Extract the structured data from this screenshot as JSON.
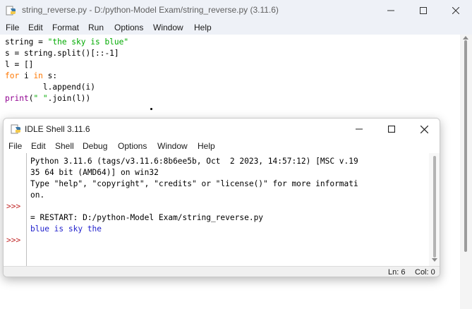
{
  "editor": {
    "title": "string_reverse.py - D:/python-Model Exam/string_reverse.py (3.11.6)",
    "menu": [
      "File",
      "Edit",
      "Format",
      "Run",
      "Options",
      "Window",
      "Help"
    ]
  },
  "code": [
    [
      {
        "t": "string = ",
        "c": "plain"
      },
      {
        "t": "\"the sky is blue\"",
        "c": "str"
      }
    ],
    [
      {
        "t": "s = string.split()[::-1]",
        "c": "plain"
      }
    ],
    [
      {
        "t": "l = []",
        "c": "plain"
      }
    ],
    [
      {
        "t": "for",
        "c": "kw"
      },
      {
        "t": " i ",
        "c": "plain"
      },
      {
        "t": "in",
        "c": "kw"
      },
      {
        "t": " s:",
        "c": "plain"
      }
    ],
    [
      {
        "t": "        l.append(i)",
        "c": "plain"
      }
    ],
    [
      {
        "t": "print",
        "c": "bi"
      },
      {
        "t": "(",
        "c": "plain"
      },
      {
        "t": "\" \"",
        "c": "str"
      },
      {
        "t": ".join(l))",
        "c": "plain"
      }
    ]
  ],
  "shell": {
    "title": "IDLE Shell 3.11.6",
    "menu": [
      "File",
      "Edit",
      "Shell",
      "Debug",
      "Options",
      "Window",
      "Help"
    ],
    "lines": [
      "Python 3.11.6 (tags/v3.11.6:8b6ee5b, Oct  2 2023, 14:57:12) [MSC v.19",
      "35 64 bit (AMD64)] on win32",
      "Type \"help\", \"copyright\", \"credits\" or \"license()\" for more informati",
      "on.",
      "",
      "= RESTART: D:/python-Model Exam/string_reverse.py",
      "blue is sky the"
    ],
    "prompts": [
      ">>>",
      ">>>"
    ],
    "status": {
      "ln": "Ln: 6",
      "col": "Col: 0"
    }
  }
}
